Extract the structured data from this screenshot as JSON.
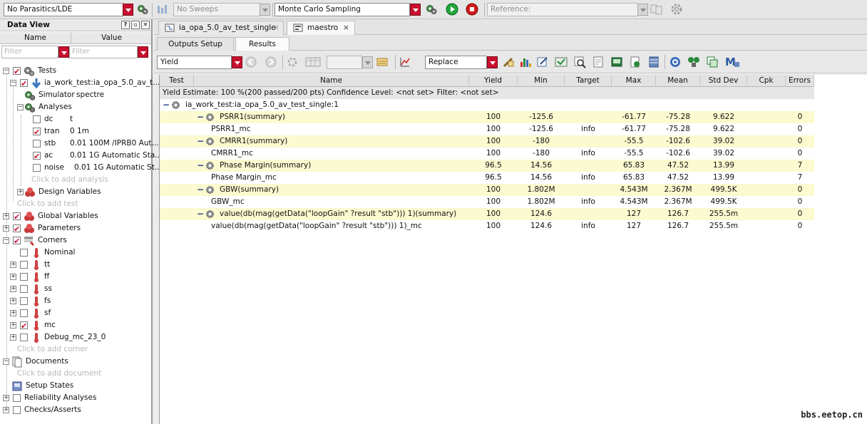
{
  "toolbar": {
    "parasitics": "No Parasitics/LDE",
    "sweeps": "No Sweeps",
    "run_mode": "Monte Carlo Sampling",
    "reference_label": "Reference:"
  },
  "data_view": {
    "title": "Data View",
    "help_btn": "?",
    "col_name": "Name",
    "col_value": "Value",
    "filter_name": "Filter",
    "filter_value": "Filter",
    "tree": [
      {
        "label": "Tests",
        "value": ""
      },
      {
        "label": "ia_work_test:ia_opa_5.0_av_t...",
        "value": ""
      },
      {
        "label": "Simulator",
        "value": "spectre"
      },
      {
        "label": "Analyses",
        "value": ""
      },
      {
        "label": "dc",
        "value": "t"
      },
      {
        "label": "tran",
        "value": "0 1m"
      },
      {
        "label": "stb",
        "value": "0.01 100M /IPRB0 Aut..."
      },
      {
        "label": "ac",
        "value": "0.01 1G Automatic Sta..."
      },
      {
        "label": "noise",
        "value": "0.01 1G Automatic St..."
      },
      {
        "label": "Click to add analysis",
        "value": ""
      },
      {
        "label": "Design Variables",
        "value": ""
      },
      {
        "label": "Click to add test",
        "value": ""
      },
      {
        "label": "Global Variables",
        "value": ""
      },
      {
        "label": "Parameters",
        "value": ""
      },
      {
        "label": "Corners",
        "value": ""
      },
      {
        "label": "Nominal",
        "value": ""
      },
      {
        "label": "tt",
        "value": ""
      },
      {
        "label": "ff",
        "value": ""
      },
      {
        "label": "ss",
        "value": ""
      },
      {
        "label": "fs",
        "value": ""
      },
      {
        "label": "sf",
        "value": ""
      },
      {
        "label": "mc",
        "value": ""
      },
      {
        "label": "Debug_mc_23_0",
        "value": ""
      },
      {
        "label": "Click to add corner",
        "value": ""
      },
      {
        "label": "Documents",
        "value": ""
      },
      {
        "label": "Click to add document",
        "value": ""
      },
      {
        "label": "Setup States",
        "value": ""
      },
      {
        "label": "Reliability Analyses",
        "value": ""
      },
      {
        "label": "Checks/Asserts",
        "value": ""
      }
    ]
  },
  "doc_tabs": [
    {
      "label": "ia_opa_5.0_av_test_single",
      "close": "×"
    },
    {
      "label": "maestro",
      "close": "×"
    }
  ],
  "sub_tabs": [
    "Outputs Setup",
    "Results"
  ],
  "results_bar": {
    "view_mode": "Yield",
    "plot_mode": "Replace"
  },
  "table": {
    "headers": [
      "Test",
      "Name",
      "Yield",
      "Min",
      "Target",
      "Max",
      "Mean",
      "Std Dev",
      "Cpk",
      "Errors"
    ],
    "estimate": "Yield Estimate: 100 %(200 passed/200 pts)    Confidence Level: <not set>   Filter: <not set>",
    "test_name": "ia_work_test:ia_opa_5.0_av_test_single:1",
    "rows": [
      {
        "kind": "summary",
        "name": "PSRR1(summary)",
        "yield": "100",
        "min": "-125.6",
        "target": "",
        "max": "-61.77",
        "mean": "-75.28",
        "std": "9.622",
        "cpk": "",
        "errors": "0"
      },
      {
        "kind": "detail",
        "name": "PSRR1_mc",
        "yield": "100",
        "min": "-125.6",
        "target": "info",
        "max": "-61.77",
        "mean": "-75.28",
        "std": "9.622",
        "cpk": "",
        "errors": "0"
      },
      {
        "kind": "summary",
        "name": "CMRR1(summary)",
        "yield": "100",
        "min": "-180",
        "target": "",
        "max": "-55.5",
        "mean": "-102.6",
        "std": "39.02",
        "cpk": "",
        "errors": "0"
      },
      {
        "kind": "detail",
        "name": "CMRR1_mc",
        "yield": "100",
        "min": "-180",
        "target": "info",
        "max": "-55.5",
        "mean": "-102.6",
        "std": "39.02",
        "cpk": "",
        "errors": "0"
      },
      {
        "kind": "summary",
        "name": "Phase Margin(summary)",
        "yield": "96.5",
        "min": "14.56",
        "target": "",
        "max": "65.83",
        "mean": "47.52",
        "std": "13.99",
        "cpk": "",
        "errors": "7"
      },
      {
        "kind": "detail",
        "name": "Phase Margin_mc",
        "yield": "96.5",
        "min": "14.56",
        "target": "info",
        "max": "65.83",
        "mean": "47.52",
        "std": "13.99",
        "cpk": "",
        "errors": "7"
      },
      {
        "kind": "summary",
        "name": "GBW(summary)",
        "yield": "100",
        "min": "1.802M",
        "target": "",
        "max": "4.543M",
        "mean": "2.367M",
        "std": "499.5K",
        "cpk": "",
        "errors": "0"
      },
      {
        "kind": "detail",
        "name": "GBW_mc",
        "yield": "100",
        "min": "1.802M",
        "target": "info",
        "max": "4.543M",
        "mean": "2.367M",
        "std": "499.5K",
        "cpk": "",
        "errors": "0"
      },
      {
        "kind": "summary",
        "name": "value(db(mag(getData(\"loopGain\" ?result \"stb\"))) 1)(summary)",
        "yield": "100",
        "min": "124.6",
        "target": "",
        "max": "127",
        "mean": "126.7",
        "std": "255.5m",
        "cpk": "",
        "errors": "0"
      },
      {
        "kind": "detail",
        "name": "value(db(mag(getData(\"loopGain\" ?result \"stb\"))) 1)_mc",
        "yield": "100",
        "min": "124.6",
        "target": "info",
        "max": "127",
        "mean": "126.7",
        "std": "255.5m",
        "cpk": "",
        "errors": "0"
      }
    ]
  },
  "watermark": "bbs.eetop.cn"
}
